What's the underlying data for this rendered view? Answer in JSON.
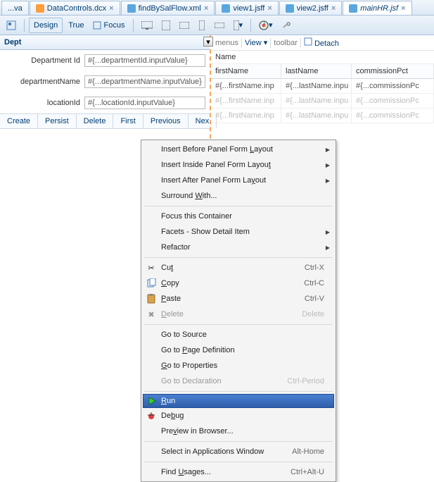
{
  "tabs": [
    {
      "label": "...va"
    },
    {
      "label": "DataControls.dcx"
    },
    {
      "label": "findBySalFlow.xml"
    },
    {
      "label": "view1.jsff"
    },
    {
      "label": "view2.jsff"
    },
    {
      "label": "mainHR.jsf"
    }
  ],
  "toolbar": {
    "design": "Design",
    "true": "True",
    "focus": "Focus"
  },
  "dept": {
    "title": "Dept",
    "fields": [
      {
        "label": "Department Id",
        "value": "#{...departmentId.inputValue}"
      },
      {
        "label": "departmentName",
        "value": "#{...departmentName.inputValue}"
      },
      {
        "label": "locationId",
        "value": "#{...locationId.inputValue}"
      }
    ],
    "buttons": [
      "Create",
      "Persist",
      "Delete",
      "First",
      "Previous",
      "Nex"
    ]
  },
  "panel": {
    "menus": "menus",
    "view": "View",
    "toolbarLabel": "toolbar",
    "detach": "Detach",
    "nameHdr": "Name",
    "cols": [
      "firstName",
      "lastName",
      "commissionPct"
    ],
    "rows": [
      [
        "#{...firstName.inp",
        "#{...lastName.inpu",
        "#{...commissionPc"
      ],
      [
        "#{...firstName.inp",
        "#{...lastName.inpu",
        "#{...commissionPc"
      ],
      [
        "#{...firstName.inp",
        "#{...lastName.inpu",
        "#{...commissionPc"
      ]
    ]
  },
  "menu": {
    "insertBefore": "Insert Before Panel Form Layout",
    "insertInside": "Insert Inside Panel Form Layout",
    "insertAfter": "Insert After Panel Form Layout",
    "surround": "Surround With...",
    "focusContainer": "Focus this Container",
    "facets": "Facets - Show Detail Item",
    "refactor": "Refactor",
    "cut": "Cut",
    "cutK": "Ctrl-X",
    "copy": "Copy",
    "copyK": "Ctrl-C",
    "paste": "Paste",
    "pasteK": "Ctrl-V",
    "delete": "Delete",
    "deleteK": "Delete",
    "goSource": "Go to Source",
    "goPageDef": "Go to Page Definition",
    "goProps": "Go to Properties",
    "goDecl": "Go to Declaration",
    "goDeclK": "Ctrl-Period",
    "run": "Run",
    "debug": "Debug",
    "preview": "Preview in Browser...",
    "selectApp": "Select in Applications Window",
    "selectAppK": "Alt-Home",
    "findUsages": "Find Usages...",
    "findUsagesK": "Ctrl+Alt-U"
  }
}
